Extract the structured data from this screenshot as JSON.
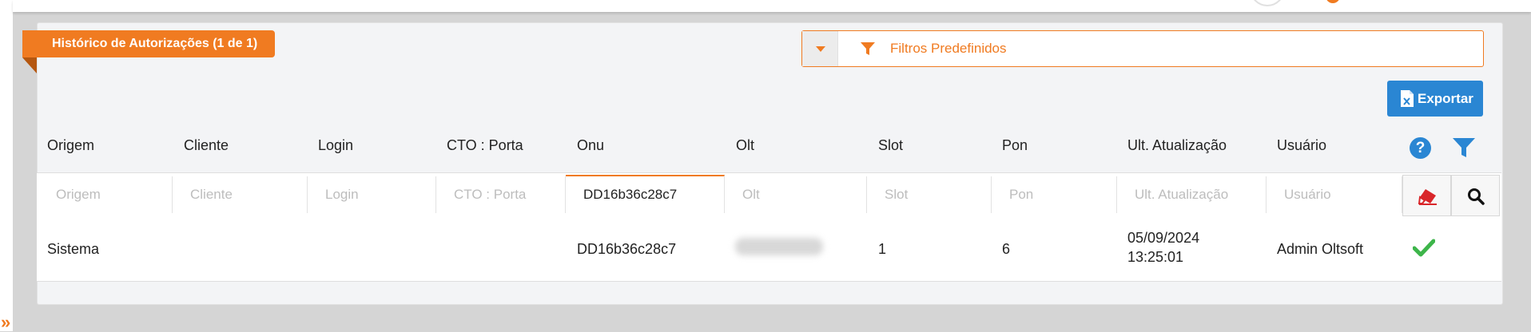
{
  "panel": {
    "title": "Histórico de Autorizações (1 de 1)"
  },
  "filters": {
    "predefined_label": "Filtros Predefinidos"
  },
  "toolbar": {
    "export_label": "Exportar"
  },
  "table": {
    "columns": [
      {
        "key": "origem",
        "label": "Origem",
        "placeholder": "Origem",
        "value": ""
      },
      {
        "key": "cliente",
        "label": "Cliente",
        "placeholder": "Cliente",
        "value": ""
      },
      {
        "key": "login",
        "label": "Login",
        "placeholder": "Login",
        "value": ""
      },
      {
        "key": "cto_porta",
        "label": "CTO : Porta",
        "placeholder": "CTO : Porta",
        "value": ""
      },
      {
        "key": "onu",
        "label": "Onu",
        "placeholder": "Onu",
        "value": "DD16b36c28c7"
      },
      {
        "key": "olt",
        "label": "Olt",
        "placeholder": "Olt",
        "value": ""
      },
      {
        "key": "slot",
        "label": "Slot",
        "placeholder": "Slot",
        "value": ""
      },
      {
        "key": "pon",
        "label": "Pon",
        "placeholder": "Pon",
        "value": ""
      },
      {
        "key": "ult_atualizacao",
        "label": "Ult. Atualização",
        "placeholder": "Ult. Atualização",
        "value": ""
      },
      {
        "key": "usuario",
        "label": "Usuário",
        "placeholder": "Usuário",
        "value": ""
      }
    ],
    "rows": [
      {
        "origem": "Sistema",
        "cliente": "",
        "login": "",
        "cto_porta": "",
        "onu": "DD16b36c28c7",
        "olt": "",
        "slot": "1",
        "pon": "6",
        "ult_atualizacao_date": "05/09/2024",
        "ult_atualizacao_time": "13:25:01",
        "usuario": "Admin Oltsoft",
        "status_icon": "check-icon"
      }
    ]
  },
  "colors": {
    "accent": "#f07b21",
    "primary": "#2a86d3",
    "success": "#3db54a",
    "danger": "#d9262a"
  }
}
